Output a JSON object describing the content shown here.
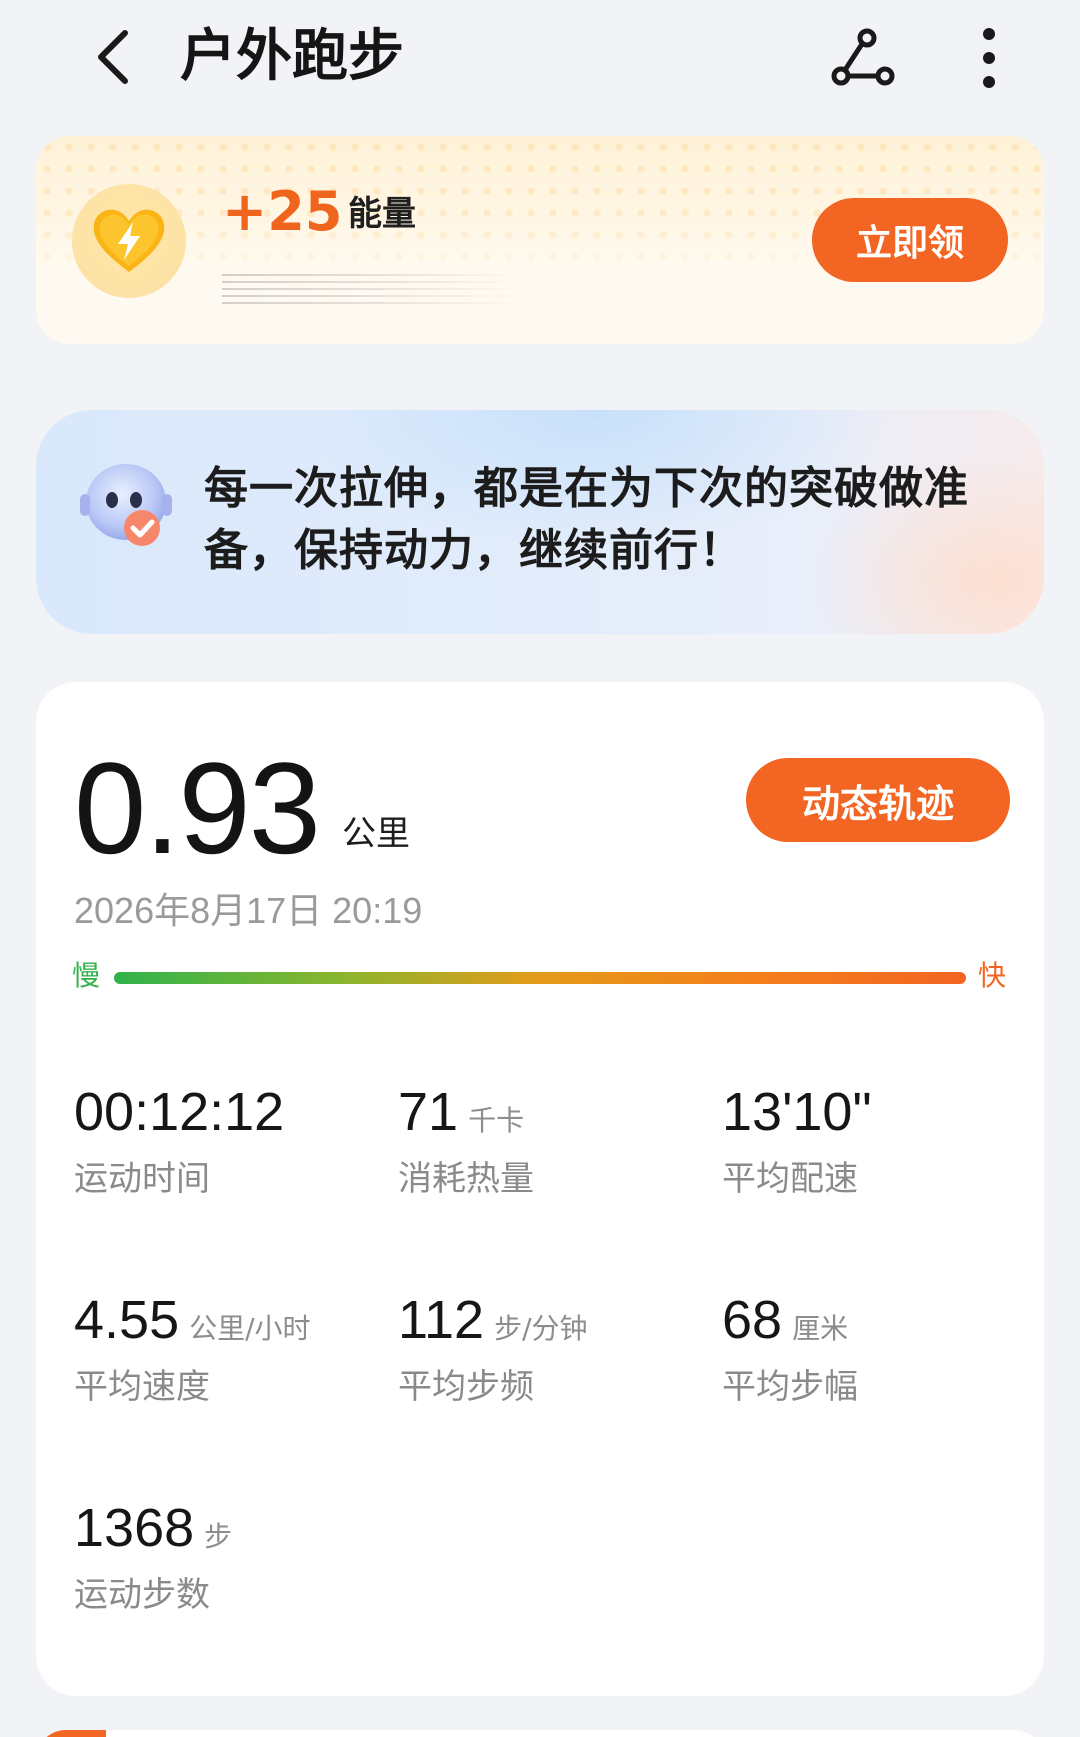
{
  "header": {
    "title": "户外跑步"
  },
  "energy": {
    "amount": "+25",
    "label": "能量",
    "claim_label": "立即领"
  },
  "motto": {
    "text": "每一次拉伸，都是在为下次的突破做准备，保持动力，继续前行！"
  },
  "summary": {
    "distance": "0.93",
    "distance_unit": "公里",
    "track_label": "动态轨迹",
    "datetime": "2026年8月17日 20:19",
    "pace_slow_label": "慢",
    "pace_fast_label": "快"
  },
  "metrics": [
    {
      "value": "00:12:12",
      "unit": "",
      "label": "运动时间"
    },
    {
      "value": "71",
      "unit": "千卡",
      "label": "消耗热量"
    },
    {
      "value": "13'10\"",
      "unit": "",
      "label": "平均配速"
    },
    {
      "value": "4.55",
      "unit": "公里/小时",
      "label": "平均速度"
    },
    {
      "value": "112",
      "unit": "步/分钟",
      "label": "平均步频"
    },
    {
      "value": "68",
      "unit": "厘米",
      "label": "平均步幅"
    },
    {
      "value": "1368",
      "unit": "步",
      "label": "运动步数"
    }
  ],
  "colors": {
    "accent": "#f26522",
    "pace_slow": "#33b24b",
    "background": "#f1f3f6"
  },
  "icons": {
    "back": "chevron-left-icon",
    "share": "route-share-icon",
    "more": "more-vertical-icon",
    "energy": "heart-bolt-icon",
    "assistant": "robot-avatar-icon"
  }
}
